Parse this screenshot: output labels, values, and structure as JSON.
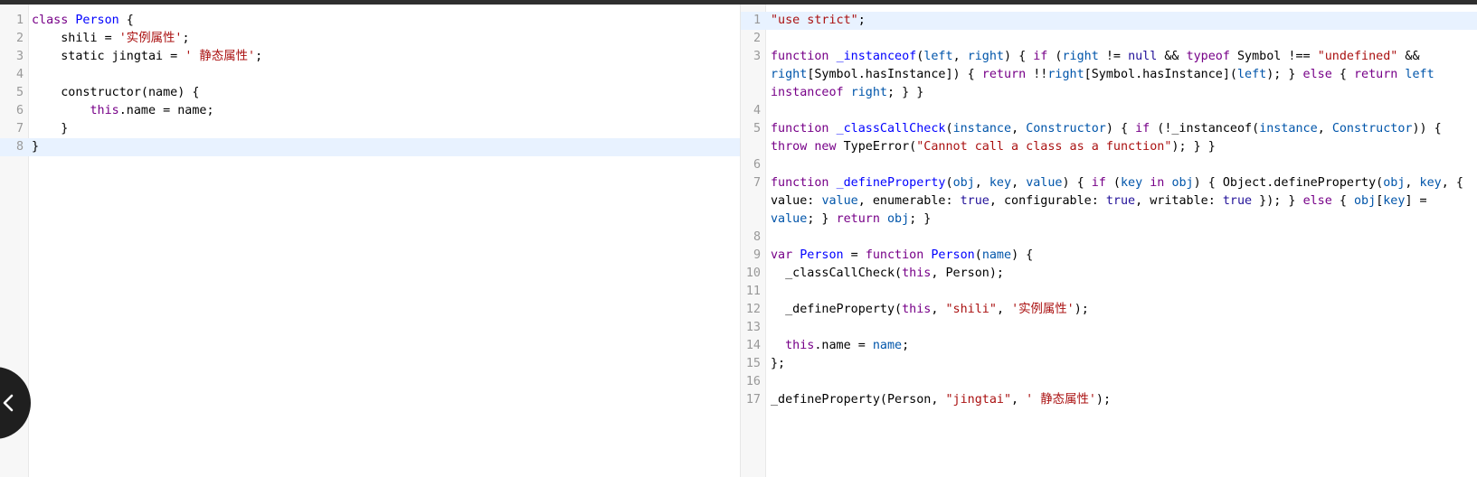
{
  "left_editor": {
    "lines": [
      {
        "n": "1",
        "t": [
          [
            "k",
            "class"
          ],
          [
            "",
            " "
          ],
          [
            "d",
            "Person"
          ],
          [
            "",
            " {"
          ]
        ]
      },
      {
        "n": "2",
        "t": [
          [
            "",
            "    shili = "
          ],
          [
            "s",
            "'实例属性'"
          ],
          [
            "",
            ";"
          ]
        ]
      },
      {
        "n": "3",
        "t": [
          [
            "",
            "    static jingtai = "
          ],
          [
            "s",
            "' 静态属性'"
          ],
          [
            "",
            ";"
          ]
        ]
      },
      {
        "n": "4",
        "t": [
          [
            "",
            ""
          ]
        ]
      },
      {
        "n": "5",
        "t": [
          [
            "",
            "    constructor(name) {"
          ]
        ]
      },
      {
        "n": "6",
        "t": [
          [
            "",
            "        "
          ],
          [
            "k",
            "this"
          ],
          [
            "",
            ".name = name;"
          ]
        ]
      },
      {
        "n": "7",
        "t": [
          [
            "",
            "    }"
          ]
        ]
      },
      {
        "n": "8",
        "active": true,
        "t": [
          [
            "",
            "}"
          ]
        ]
      }
    ]
  },
  "right_editor": {
    "lines": [
      {
        "n": "1",
        "active": true,
        "t": [
          [
            "s",
            "\"use strict\""
          ],
          [
            "",
            ";"
          ]
        ]
      },
      {
        "n": "2",
        "t": [
          [
            "",
            ""
          ]
        ]
      },
      {
        "n": "3",
        "t": [
          [
            "k",
            "function"
          ],
          [
            "",
            " "
          ],
          [
            "d",
            "_instanceof"
          ],
          [
            "",
            "("
          ],
          [
            "v",
            "left"
          ],
          [
            "",
            ", "
          ],
          [
            "v",
            "right"
          ],
          [
            ") ",
            ") { "
          ],
          [
            "k",
            "if"
          ],
          [
            "",
            " ("
          ],
          [
            "v",
            "right"
          ],
          [
            "",
            " != "
          ],
          [
            "a",
            "null"
          ],
          [
            "",
            " && "
          ],
          [
            "k",
            "typeof"
          ],
          [
            "",
            " Symbol !== "
          ],
          [
            "s",
            "\"undefined\""
          ],
          [
            "",
            " && "
          ],
          [
            "v",
            "right"
          ],
          [
            "",
            "[Symbol.hasInstance]) { "
          ],
          [
            "k",
            "return"
          ],
          [
            "",
            " !!"
          ],
          [
            "v",
            "right"
          ],
          [
            "",
            "[Symbol.hasInstance]("
          ],
          [
            "v",
            "left"
          ],
          [
            "",
            "); } "
          ],
          [
            "k",
            "else"
          ],
          [
            "",
            " { "
          ],
          [
            "k",
            "return"
          ],
          [
            "",
            " "
          ],
          [
            "v",
            "left"
          ],
          [
            "",
            " "
          ],
          [
            "k",
            "instanceof"
          ],
          [
            "",
            " "
          ],
          [
            "v",
            "right"
          ],
          [
            "",
            "; } }"
          ]
        ]
      },
      {
        "n": "4",
        "t": [
          [
            "",
            ""
          ]
        ]
      },
      {
        "n": "5",
        "t": [
          [
            "k",
            "function"
          ],
          [
            "",
            " "
          ],
          [
            "d",
            "_classCallCheck"
          ],
          [
            "",
            "("
          ],
          [
            "v",
            "instance"
          ],
          [
            "",
            ", "
          ],
          [
            "v",
            "Constructor"
          ],
          [
            "",
            ") { "
          ],
          [
            "k",
            "if"
          ],
          [
            "",
            " (!_instanceof("
          ],
          [
            "v",
            "instance"
          ],
          [
            "",
            ", "
          ],
          [
            "v",
            "Constructor"
          ],
          [
            "",
            ")) { "
          ],
          [
            "k",
            "throw"
          ],
          [
            "",
            " "
          ],
          [
            "k",
            "new"
          ],
          [
            "",
            " TypeError("
          ],
          [
            "s",
            "\"Cannot call a class as a function\""
          ],
          [
            "",
            "); } }"
          ]
        ]
      },
      {
        "n": "6",
        "t": [
          [
            "",
            ""
          ]
        ]
      },
      {
        "n": "7",
        "t": [
          [
            "k",
            "function"
          ],
          [
            "",
            " "
          ],
          [
            "d",
            "_defineProperty"
          ],
          [
            "",
            "("
          ],
          [
            "v",
            "obj"
          ],
          [
            "",
            ", "
          ],
          [
            "v",
            "key"
          ],
          [
            "",
            ", "
          ],
          [
            "v",
            "value"
          ],
          [
            "",
            ") { "
          ],
          [
            "k",
            "if"
          ],
          [
            "",
            " ("
          ],
          [
            "v",
            "key"
          ],
          [
            "",
            " "
          ],
          [
            "k",
            "in"
          ],
          [
            "",
            " "
          ],
          [
            "v",
            "obj"
          ],
          [
            "",
            ") { Object.defineProperty("
          ],
          [
            "v",
            "obj"
          ],
          [
            "",
            ", "
          ],
          [
            "v",
            "key"
          ],
          [
            "",
            ", { value: "
          ],
          [
            "v",
            "value"
          ],
          [
            "",
            ", enumerable: "
          ],
          [
            "a",
            "true"
          ],
          [
            "",
            ", configurable: "
          ],
          [
            "a",
            "true"
          ],
          [
            "",
            ", writable: "
          ],
          [
            "a",
            "true"
          ],
          [
            "",
            " }); } "
          ],
          [
            "k",
            "else"
          ],
          [
            "",
            " { "
          ],
          [
            "v",
            "obj"
          ],
          [
            "",
            "["
          ],
          [
            "v",
            "key"
          ],
          [
            "",
            "] = "
          ],
          [
            "v",
            "value"
          ],
          [
            "",
            "; } "
          ],
          [
            "k",
            "return"
          ],
          [
            "",
            " "
          ],
          [
            "v",
            "obj"
          ],
          [
            "",
            "; }"
          ]
        ]
      },
      {
        "n": "8",
        "t": [
          [
            "",
            ""
          ]
        ]
      },
      {
        "n": "9",
        "t": [
          [
            "k",
            "var"
          ],
          [
            "",
            " "
          ],
          [
            "d",
            "Person"
          ],
          [
            "",
            " = "
          ],
          [
            "k",
            "function"
          ],
          [
            "",
            " "
          ],
          [
            "d",
            "Person"
          ],
          [
            "",
            "("
          ],
          [
            "v",
            "name"
          ],
          [
            "",
            ") {"
          ]
        ]
      },
      {
        "n": "10",
        "t": [
          [
            "",
            "  _classCallCheck("
          ],
          [
            "k",
            "this"
          ],
          [
            "",
            ", Person);"
          ]
        ]
      },
      {
        "n": "11",
        "t": [
          [
            "",
            ""
          ]
        ]
      },
      {
        "n": "12",
        "t": [
          [
            "",
            "  _defineProperty("
          ],
          [
            "k",
            "this"
          ],
          [
            "",
            ", "
          ],
          [
            "s",
            "\"shili\""
          ],
          [
            "",
            ", "
          ],
          [
            "s",
            "'实例属性'"
          ],
          [
            "",
            ");"
          ]
        ]
      },
      {
        "n": "13",
        "t": [
          [
            "",
            ""
          ]
        ]
      },
      {
        "n": "14",
        "t": [
          [
            "",
            "  "
          ],
          [
            "k",
            "this"
          ],
          [
            "",
            ".name = "
          ],
          [
            "v",
            "name"
          ],
          [
            "",
            ";"
          ]
        ]
      },
      {
        "n": "15",
        "t": [
          [
            "",
            "};"
          ]
        ]
      },
      {
        "n": "16",
        "t": [
          [
            "",
            ""
          ]
        ]
      },
      {
        "n": "17",
        "t": [
          [
            "",
            "_defineProperty(Person, "
          ],
          [
            "s",
            "\"jingtai\""
          ],
          [
            "",
            ", "
          ],
          [
            "s",
            "' 静态属性'"
          ],
          [
            "",
            ");"
          ]
        ]
      }
    ]
  },
  "sidebar_toggle": {
    "icon": "chevron-left-icon"
  }
}
